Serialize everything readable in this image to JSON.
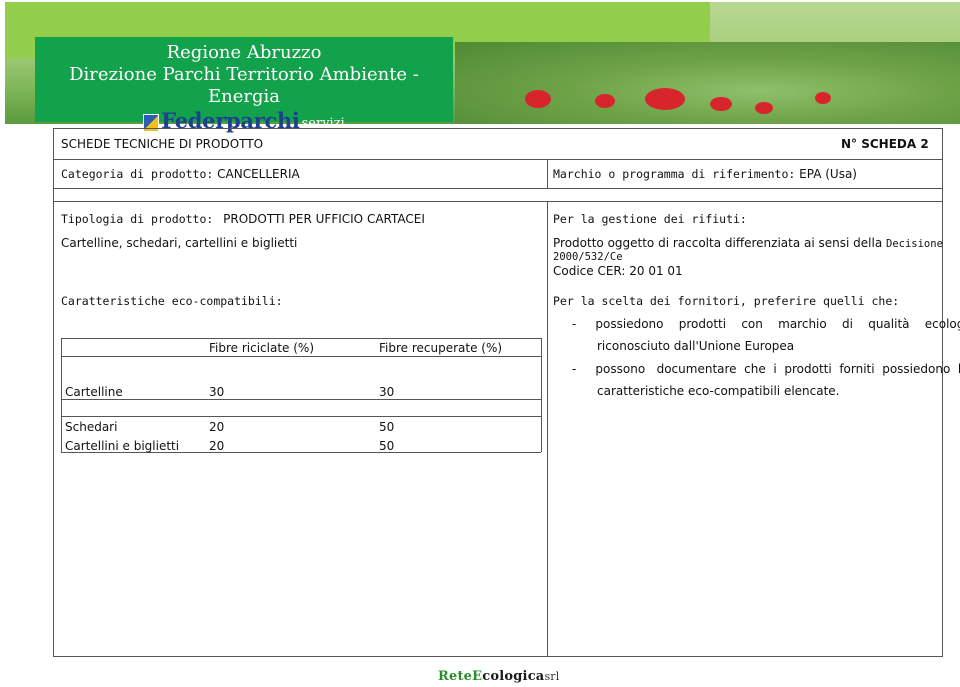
{
  "header": {
    "line1": "Regione Abruzzo",
    "line2": "Direzione Parchi  Territorio  Ambiente - Energia",
    "fed_name": "Federparchi",
    "fed_sub": "servizi"
  },
  "sheet": {
    "title": "SCHEDE TECNICHE DI PRODOTTO",
    "number": "N° SCHEDA 2",
    "category_label": "Categoria di prodotto:",
    "category_value": "CANCELLERIA",
    "brand_label": "Marchio o programma di riferimento:",
    "brand_value": "EPA (Usa)",
    "type_label": "Tipologia di prodotto:",
    "type_value": "PRODOTTI PER UFFICIO CARTACEI",
    "type_sub": "Cartelline, schedari, cartellini e biglietti",
    "waste_title": "Per la gestione dei rifiuti:",
    "waste_line1": "Prodotto oggetto di raccolta differenziata ai sensi della",
    "waste_line1b": "Decisione",
    "waste_line2": "2000/532/Ce",
    "waste_line3": "Codice CER: 20 01 01",
    "eco_title": "Caratteristiche eco-compatibili:",
    "suppliers_title": "Per la scelta dei fornitori, preferire quelli che:",
    "bullet1a": "-     possiedono    prodotti    con    marchio    di    qualità    ecologica",
    "bullet1b": "riconosciuto dall'Unione Europea",
    "bullet2a": "-     possono   documentare  che  i  prodotti  forniti  possiedono  le",
    "bullet2b": "caratteristiche eco-compatibili elencate."
  },
  "table": {
    "col1": "Fibre riciclate (%)",
    "col2": "Fibre recuperate (%)",
    "rows": [
      {
        "name": "Cartelline",
        "riciclate": "30",
        "recuperate": "30"
      },
      {
        "name": "Schedari",
        "riciclate": "20",
        "recuperate": "50"
      },
      {
        "name": "Cartellini e biglietti",
        "riciclate": "20",
        "recuperate": "50"
      }
    ]
  },
  "footer": {
    "logo_part1": "Rete",
    "logo_part2": "cologica",
    "logo_e": "E",
    "logo_srl": "srl"
  },
  "colors": {
    "banner_green": "#12a24c",
    "light_green": "#92cd4b",
    "poppy_red": "#d8242b"
  }
}
